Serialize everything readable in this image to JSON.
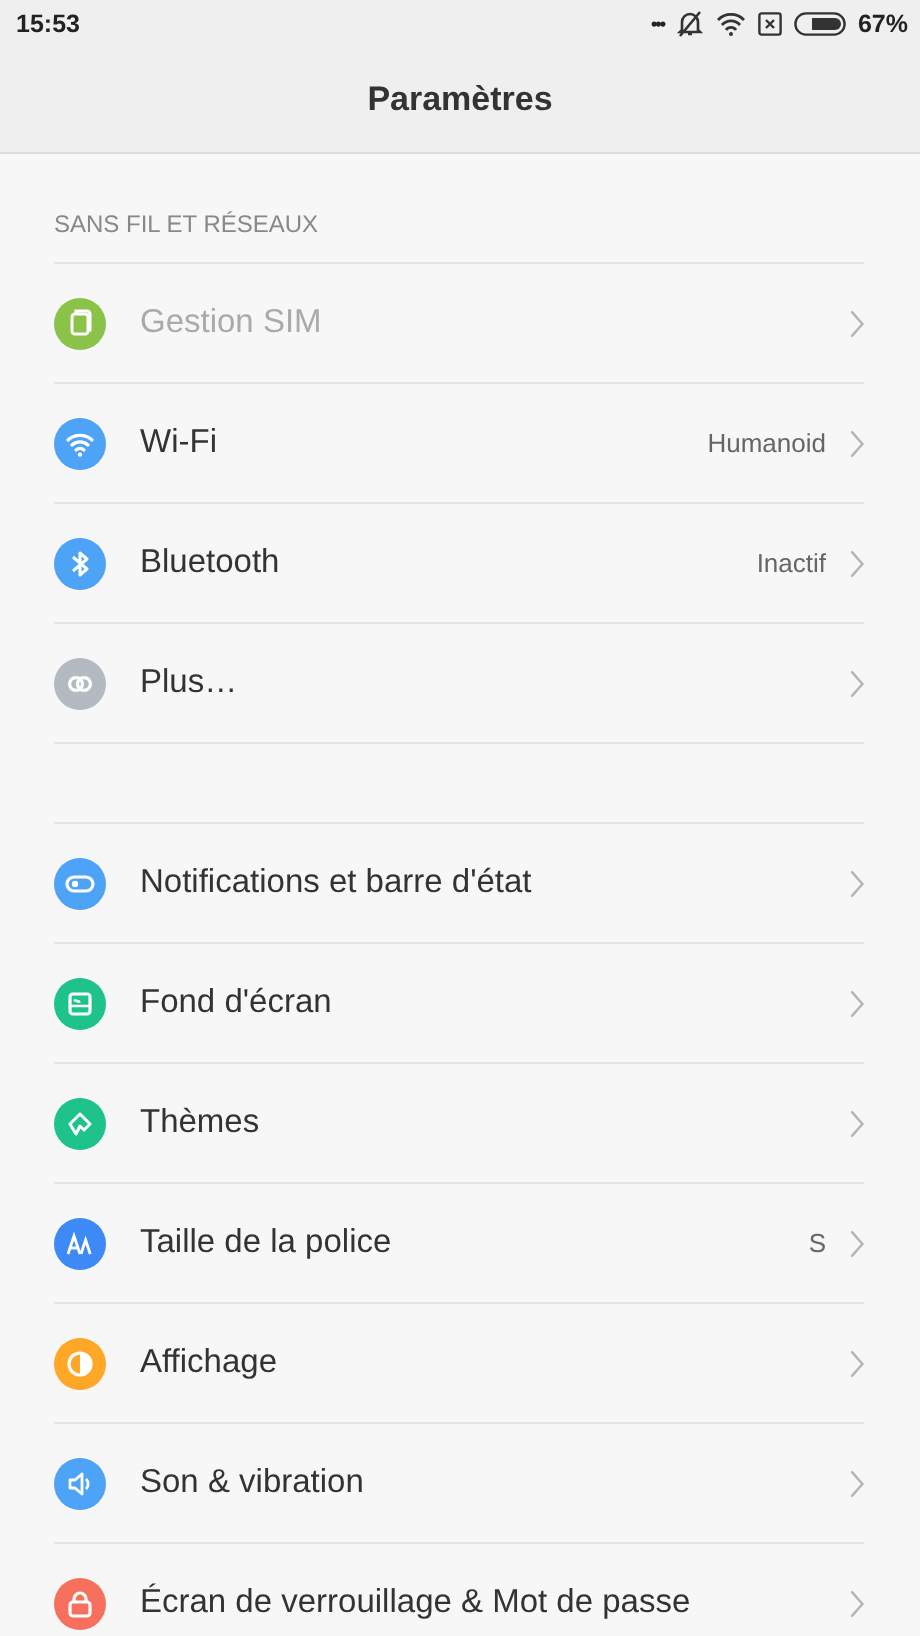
{
  "status_bar": {
    "time": "15:53",
    "dots": "•••",
    "battery_percent": "67%"
  },
  "title": "Paramètres",
  "groups": [
    {
      "header": "SANS FIL ET RÉSEAUX",
      "items": [
        {
          "label": "Gestion SIM",
          "color": "#8bc34a",
          "disabled": true
        },
        {
          "label": "Wi-Fi",
          "value": "Humanoid",
          "color": "#4da3f5",
          "disabled": false
        },
        {
          "label": "Bluetooth",
          "value": "Inactif",
          "color": "#4da3f5",
          "disabled": false
        },
        {
          "label": "Plus…",
          "color": "#b3bac2",
          "disabled": false
        }
      ]
    },
    {
      "items": [
        {
          "label": "Notifications et barre d'état",
          "color": "#4da3f5",
          "disabled": false
        },
        {
          "label": "Fond d'écran",
          "color": "#1ec28b",
          "disabled": false
        },
        {
          "label": "Thèmes",
          "color": "#1ec28b",
          "disabled": false
        },
        {
          "label": "Taille de la police",
          "value": "S",
          "color": "#3d8af7",
          "disabled": false
        },
        {
          "label": "Affichage",
          "color": "#ffa726",
          "disabled": false
        },
        {
          "label": "Son & vibration",
          "color": "#4da3f5",
          "disabled": false
        },
        {
          "label": "Écran de verrouillage & Mot de passe",
          "color": "#f7705e",
          "disabled": false
        }
      ]
    }
  ]
}
